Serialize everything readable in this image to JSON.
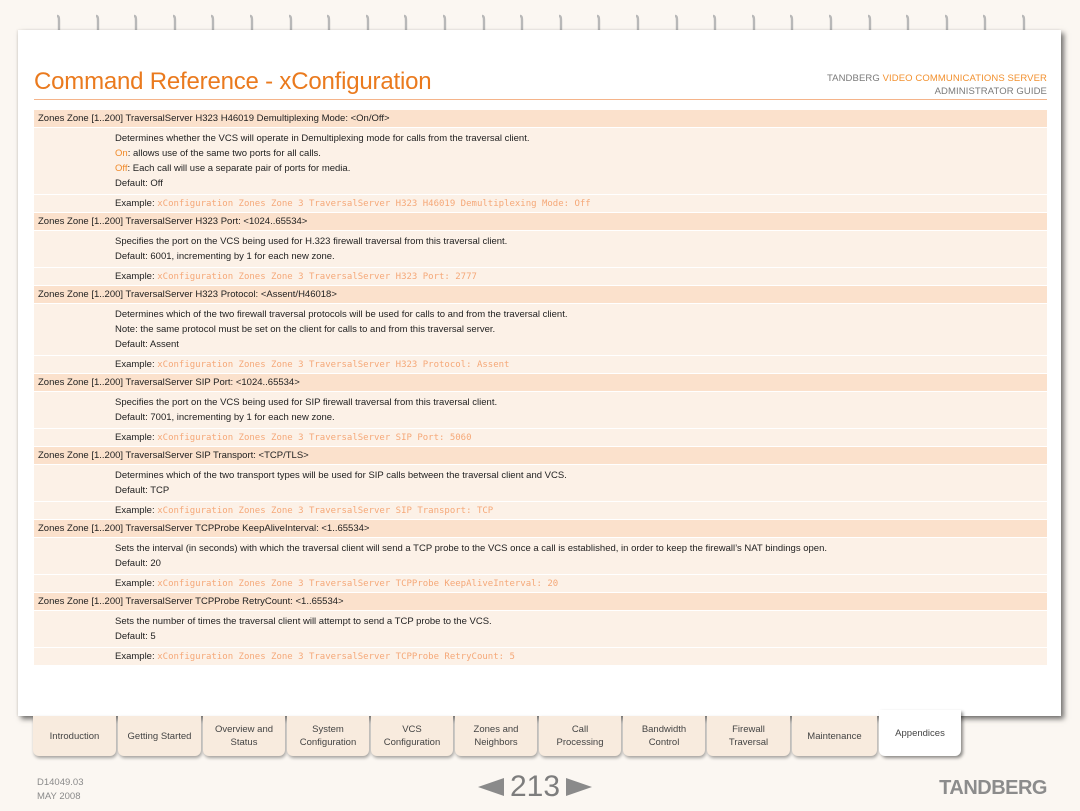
{
  "header": {
    "title": "Command Reference - xConfiguration",
    "brand_prefix": "TANDBERG",
    "brand_product": "VIDEO COMMUNICATIONS SERVER",
    "brand_guide": "ADMINISTRATOR GUIDE"
  },
  "colors": {
    "accent": "#ea7a1e",
    "header_row": "#fbe1cc",
    "body_row": "#fcf1e7",
    "example_code": "#f5a878"
  },
  "entries": [
    {
      "header": "Zones Zone [1..200] TraversalServer H323 H46019 Demultiplexing Mode: <On/Off>",
      "lines": [
        {
          "text": "Determines whether the VCS will operate in Demultiplexing mode for calls from the traversal client."
        },
        {
          "kw": "On",
          "text": ": allows use of the same two ports for all calls."
        },
        {
          "kw": "Off",
          "text": ": Each call will use a separate pair of ports for media."
        },
        {
          "text": "Default: Off"
        }
      ],
      "example_label": "Example:",
      "example_code": "xConfiguration Zones Zone 3 TraversalServer H323 H46019 Demultiplexing Mode: Off"
    },
    {
      "header": "Zones Zone [1..200] TraversalServer H323 Port: <1024..65534>",
      "lines": [
        {
          "text": "Specifies the port on the VCS being used for H.323 firewall traversal from this traversal client."
        },
        {
          "text": "Default: 6001, incrementing by 1 for each new zone."
        }
      ],
      "example_label": "Example:",
      "example_code": "xConfiguration Zones Zone 3 TraversalServer H323 Port: 2777"
    },
    {
      "header": "Zones Zone [1..200] TraversalServer H323 Protocol: <Assent/H46018>",
      "lines": [
        {
          "text": "Determines which of the two firewall traversal protocols will be used for calls to and from the traversal client."
        },
        {
          "text": "Note: the same protocol must be set on the client for calls to and from this traversal server."
        },
        {
          "text": "Default: Assent"
        }
      ],
      "example_label": "Example:",
      "example_code": "xConfiguration Zones Zone 3 TraversalServer H323 Protocol: Assent"
    },
    {
      "header": "Zones Zone [1..200] TraversalServer SIP Port: <1024..65534>",
      "lines": [
        {
          "text": "Specifies the port on the VCS being used for SIP firewall traversal from this traversal client."
        },
        {
          "text": "Default: 7001, incrementing by 1 for each new zone."
        }
      ],
      "example_label": "Example:",
      "example_code": "xConfiguration Zones Zone 3 TraversalServer SIP Port: 5060"
    },
    {
      "header": "Zones Zone [1..200] TraversalServer SIP Transport: <TCP/TLS>",
      "lines": [
        {
          "text": "Determines which of the two transport types will be used for SIP calls between the traversal client and VCS."
        },
        {
          "text": "Default: TCP"
        }
      ],
      "example_label": "Example:",
      "example_code": "xConfiguration Zones Zone 3 TraversalServer SIP Transport: TCP"
    },
    {
      "header": "Zones Zone [1..200] TraversalServer TCPProbe KeepAliveInterval: <1..65534>",
      "lines": [
        {
          "text": "Sets the interval (in seconds) with which the traversal client will send a TCP probe to the VCS once a call is established, in order to keep the firewall’s NAT bindings open."
        },
        {
          "text": "Default: 20"
        }
      ],
      "example_label": "Example:",
      "example_code": "xConfiguration Zones Zone 3 TraversalServer TCPProbe KeepAliveInterval: 20"
    },
    {
      "header": "Zones Zone [1..200] TraversalServer TCPProbe RetryCount: <1..65534>",
      "lines": [
        {
          "text": "Sets the number of times the traversal client will attempt to send a TCP probe to the VCS."
        },
        {
          "text": "Default: 5"
        }
      ],
      "example_label": "Example:",
      "example_code": "xConfiguration Zones Zone 3 TraversalServer TCPProbe RetryCount: 5"
    }
  ],
  "tabs": [
    {
      "label": "Introduction"
    },
    {
      "label": "Getting Started"
    },
    {
      "label": "Overview and\nStatus"
    },
    {
      "label": "System\nConfiguration"
    },
    {
      "label": "VCS\nConfiguration"
    },
    {
      "label": "Zones and\nNeighbors"
    },
    {
      "label": "Call\nProcessing"
    },
    {
      "label": "Bandwidth\nControl"
    },
    {
      "label": "Firewall\nTraversal"
    },
    {
      "label": "Maintenance"
    },
    {
      "label": "Appendices",
      "active": true
    }
  ],
  "footer": {
    "doc_id": "D14049.03",
    "date": "MAY 2008",
    "page_number": "213",
    "logo": "TANDBERG"
  }
}
